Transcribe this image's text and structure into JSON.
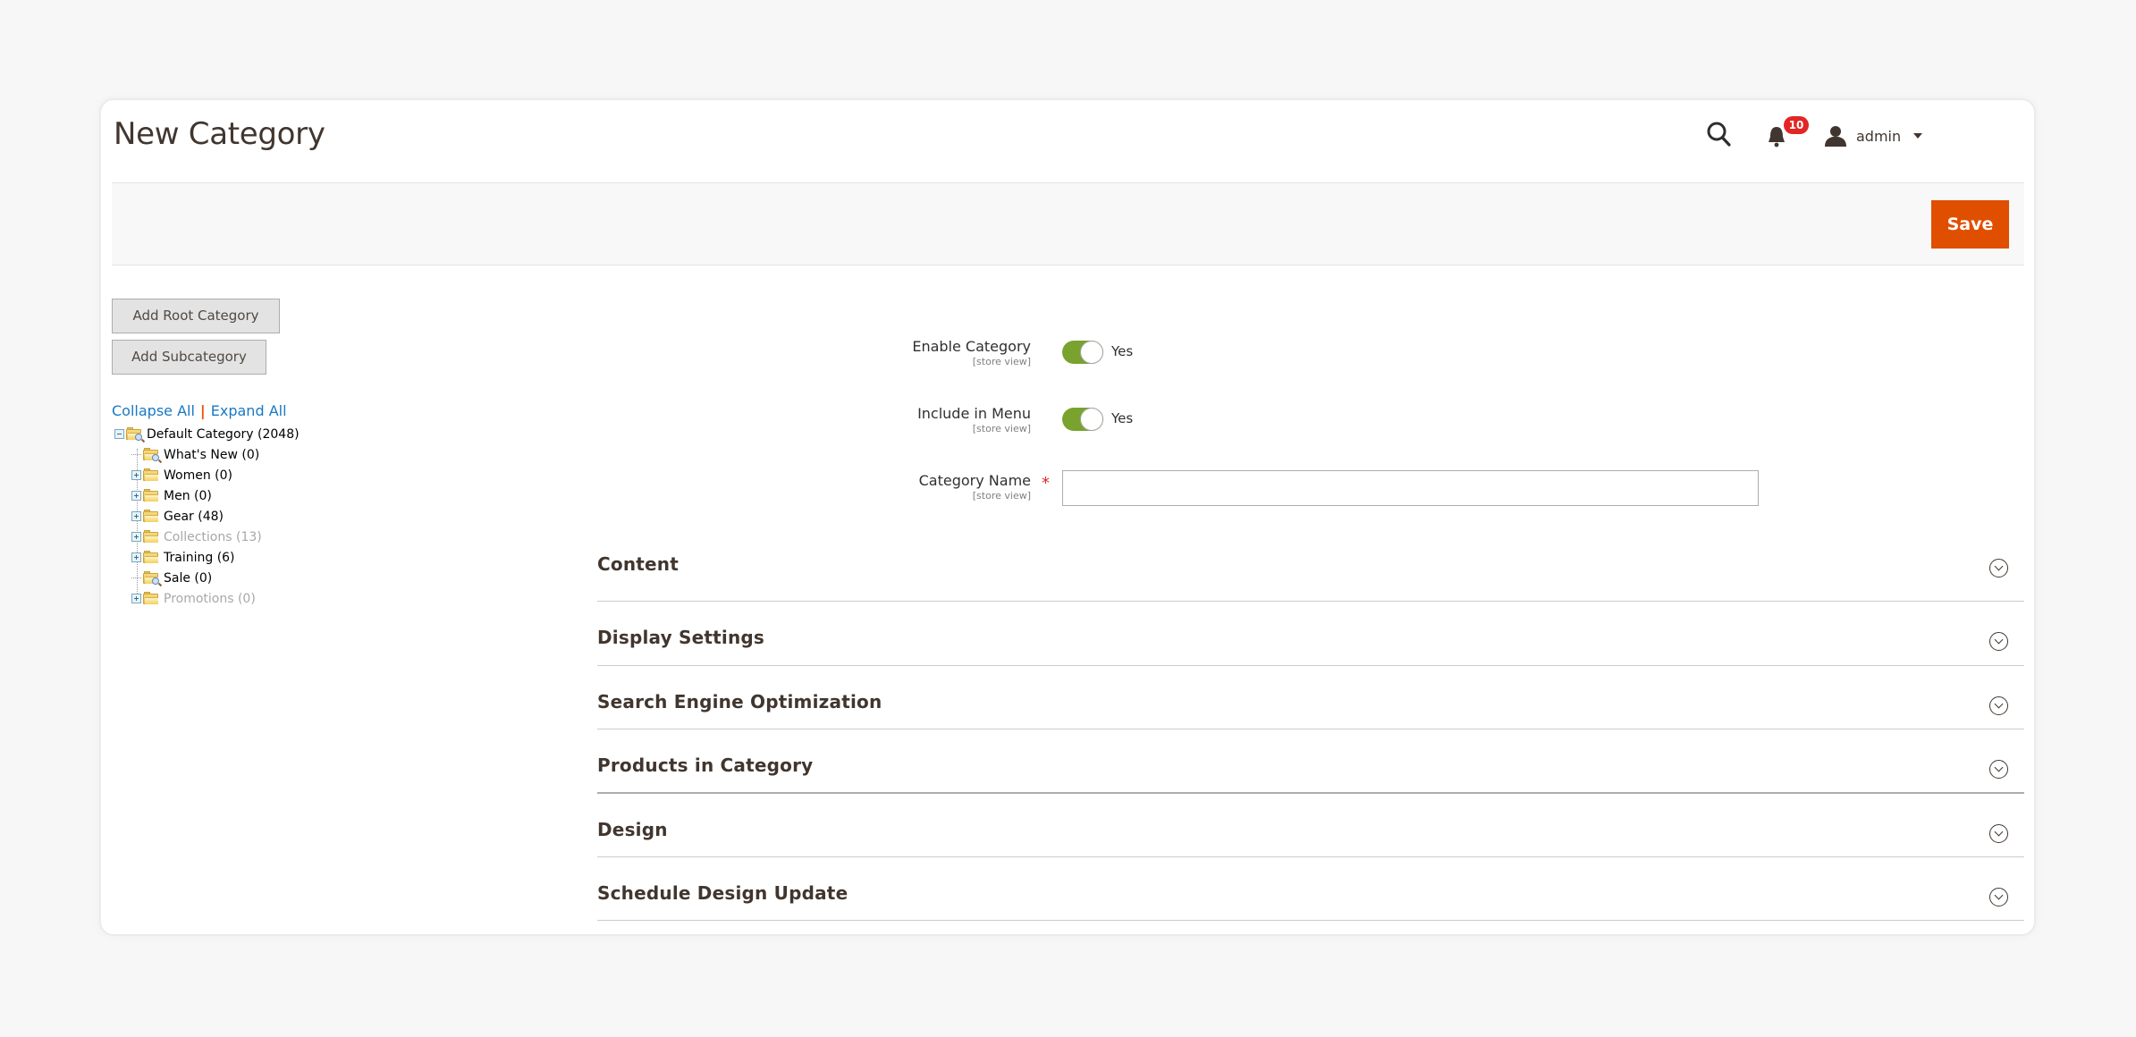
{
  "page": {
    "title": "New Category"
  },
  "header": {
    "search_icon": "search-icon",
    "notifications": {
      "icon": "bell-icon",
      "count": "10"
    },
    "user": {
      "icon": "user-icon",
      "name": "admin"
    }
  },
  "action_bar": {
    "save_label": "Save",
    "save_color": "#e04f00"
  },
  "tree_panel": {
    "add_root_label": "Add Root Category",
    "add_sub_label": "Add Subcategory",
    "collapse_all": "Collapse All",
    "separator": "|",
    "expand_all": "Expand All",
    "root": {
      "label": "Default Category (2048)",
      "expanded": true,
      "icon": "folder-search-icon"
    },
    "children": [
      {
        "label": "What's New (0)",
        "expandable": false,
        "muted": false,
        "icon": "folder-search-icon"
      },
      {
        "label": "Women (0)",
        "expandable": true,
        "muted": false,
        "icon": "folder-icon"
      },
      {
        "label": "Men (0)",
        "expandable": true,
        "muted": false,
        "icon": "folder-icon"
      },
      {
        "label": "Gear (48)",
        "expandable": true,
        "muted": false,
        "icon": "folder-icon"
      },
      {
        "label": "Collections (13)",
        "expandable": true,
        "muted": true,
        "icon": "folder-icon"
      },
      {
        "label": "Training (6)",
        "expandable": true,
        "muted": false,
        "icon": "folder-icon"
      },
      {
        "label": "Sale (0)",
        "expandable": false,
        "muted": false,
        "icon": "folder-search-icon"
      },
      {
        "label": "Promotions (0)",
        "expandable": true,
        "muted": true,
        "icon": "folder-icon"
      }
    ]
  },
  "form": {
    "enable_category": {
      "label": "Enable Category",
      "scope": "[store view]",
      "value": "Yes",
      "checked": true
    },
    "include_in_menu": {
      "label": "Include in Menu",
      "scope": "[store view]",
      "value": "Yes",
      "checked": true
    },
    "category_name": {
      "label": "Category Name",
      "scope": "[store view]",
      "required": true,
      "value": "",
      "placeholder": ""
    }
  },
  "sections": [
    {
      "title": "Content"
    },
    {
      "title": "Display Settings"
    },
    {
      "title": "Search Engine Optimization"
    },
    {
      "title": "Products in Category"
    },
    {
      "title": "Design"
    },
    {
      "title": "Schedule Design Update"
    }
  ],
  "colors": {
    "accent": "#e04f00",
    "toggle_on": "#79a22e",
    "link": "#1979c3",
    "badge": "#e22626"
  }
}
